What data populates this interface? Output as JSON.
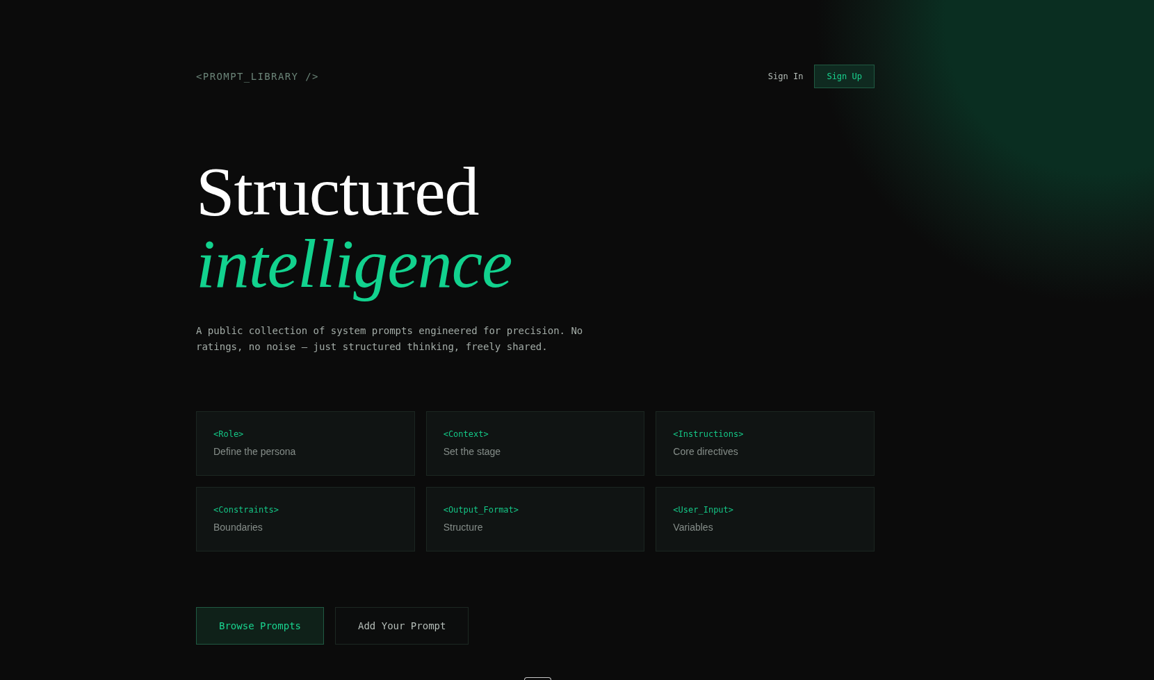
{
  "header": {
    "logo": "<PROMPT_LIBRARY />",
    "sign_in": "Sign In",
    "sign_up": "Sign Up"
  },
  "hero": {
    "title_line_1": "Structured",
    "title_line_2": "intelligence",
    "description": "A public collection of system prompts engineered for precision. No ratings, no noise — just structured thinking, freely shared."
  },
  "sections": [
    {
      "tag": "<Role>",
      "description": "Define the persona"
    },
    {
      "tag": "<Context>",
      "description": "Set the stage"
    },
    {
      "tag": "<Instructions>",
      "description": "Core directives"
    },
    {
      "tag": "<Constraints>",
      "description": "Boundaries"
    },
    {
      "tag": "<Output_Format>",
      "description": "Structure"
    },
    {
      "tag": "<User_Input>",
      "description": "Variables"
    }
  ],
  "actions": [
    {
      "label": "Browse Prompts",
      "kind": "primary"
    },
    {
      "label": "Add Your Prompt",
      "kind": "secondary"
    }
  ]
}
